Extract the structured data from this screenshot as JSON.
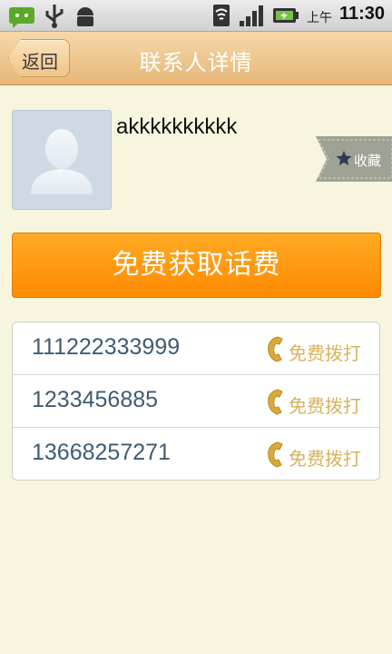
{
  "status_bar": {
    "ampm": "上午",
    "time": "11:30"
  },
  "title_bar": {
    "back_label": "返回",
    "title": "联系人详情"
  },
  "contact": {
    "name": "akkkkkkkkkk",
    "favorite_label": "收藏"
  },
  "cta": {
    "label": "免费获取话费"
  },
  "phones": [
    {
      "number": "111222333999",
      "action": "免费拨打"
    },
    {
      "number": "1233456885",
      "action": "免费拨打"
    },
    {
      "number": "13668257271",
      "action": "免费拨打"
    }
  ],
  "colors": {
    "background": "#f7f5dd",
    "title_bar": "#e6b77a",
    "cta": "#ff8a00",
    "phone_number": "#3f5b73",
    "call_action": "#d8b25c"
  }
}
